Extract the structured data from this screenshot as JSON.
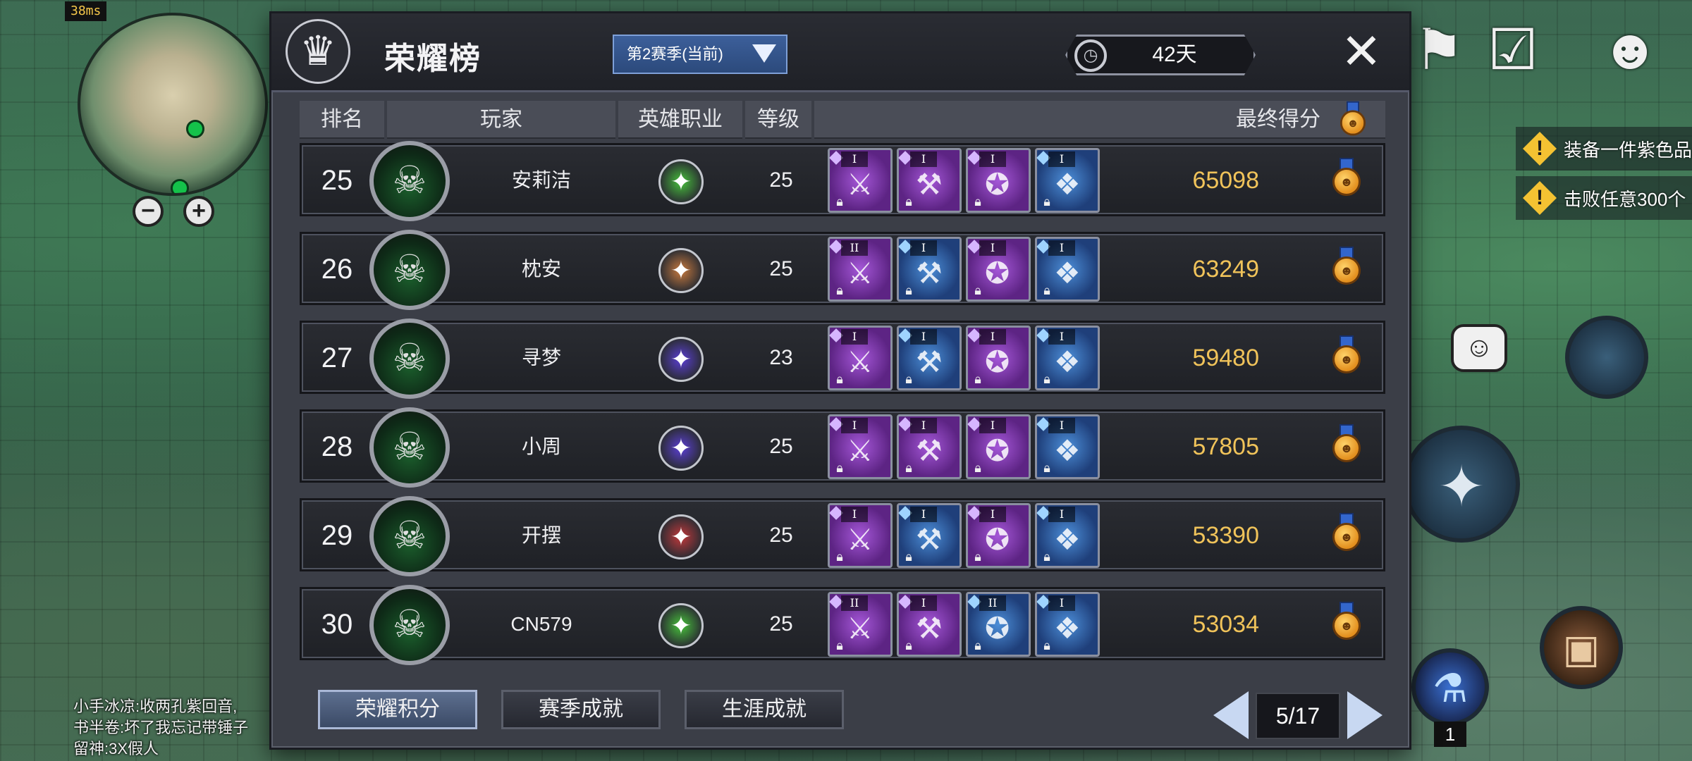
{
  "hud": {
    "ping": "38ms",
    "chat": [
      "小手冰凉:收两孔紫回音,",
      "书半卷:坏了我忘记带锤子",
      "留神:3X假人"
    ],
    "quests": [
      {
        "label": "装备一件紫色品"
      },
      {
        "label": "击败任意300个"
      }
    ],
    "badge_count": "1"
  },
  "panel": {
    "title": "荣耀榜",
    "season": "第2赛季(当前)",
    "timer": "42天",
    "columns": {
      "rank": "排名",
      "player": "玩家",
      "class": "英雄职业",
      "level": "等级",
      "score": "最终得分"
    },
    "rows": [
      {
        "rank": "25",
        "name": "安莉洁",
        "level": "25",
        "score": "65098",
        "class_color": "#47c23b",
        "items": [
          {
            "tier": "I",
            "color": "purple"
          },
          {
            "tier": "I",
            "color": "purple"
          },
          {
            "tier": "I",
            "color": "purple"
          },
          {
            "tier": "I",
            "color": "blue"
          }
        ]
      },
      {
        "rank": "26",
        "name": "枕安",
        "level": "25",
        "score": "63249",
        "class_color": "#c97a3e",
        "items": [
          {
            "tier": "II",
            "color": "purple"
          },
          {
            "tier": "I",
            "color": "blue"
          },
          {
            "tier": "I",
            "color": "purple"
          },
          {
            "tier": "I",
            "color": "blue"
          }
        ]
      },
      {
        "rank": "27",
        "name": "寻梦",
        "level": "23",
        "score": "59480",
        "class_color": "#5b3fd6",
        "items": [
          {
            "tier": "I",
            "color": "purple"
          },
          {
            "tier": "I",
            "color": "blue"
          },
          {
            "tier": "I",
            "color": "purple"
          },
          {
            "tier": "I",
            "color": "blue"
          }
        ]
      },
      {
        "rank": "28",
        "name": "小周",
        "level": "25",
        "score": "57805",
        "class_color": "#5b3fd6",
        "items": [
          {
            "tier": "I",
            "color": "purple"
          },
          {
            "tier": "I",
            "color": "purple"
          },
          {
            "tier": "I",
            "color": "purple"
          },
          {
            "tier": "I",
            "color": "blue"
          }
        ]
      },
      {
        "rank": "29",
        "name": "开摆",
        "level": "25",
        "score": "53390",
        "class_color": "#c2383b",
        "items": [
          {
            "tier": "I",
            "color": "purple"
          },
          {
            "tier": "I",
            "color": "blue"
          },
          {
            "tier": "I",
            "color": "purple"
          },
          {
            "tier": "I",
            "color": "blue"
          }
        ]
      },
      {
        "rank": "30",
        "name": "CN579",
        "level": "25",
        "score": "53034",
        "class_color": "#47c23b",
        "items": [
          {
            "tier": "II",
            "color": "purple"
          },
          {
            "tier": "I",
            "color": "purple"
          },
          {
            "tier": "II",
            "color": "blue"
          },
          {
            "tier": "I",
            "color": "blue"
          }
        ]
      }
    ],
    "tabs": [
      {
        "label": "荣耀积分",
        "active": true
      },
      {
        "label": "赛季成就",
        "active": false
      },
      {
        "label": "生涯成就",
        "active": false
      }
    ],
    "pager": "5/17"
  }
}
